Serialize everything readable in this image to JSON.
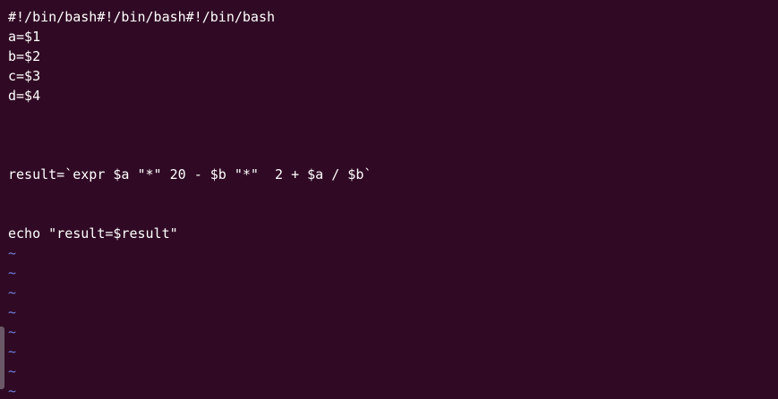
{
  "editor": {
    "lines": [
      "#!/bin/bash#!/bin/bash#!/bin/bash",
      "a=$1",
      "b=$2",
      "c=$3",
      "d=$4",
      "",
      "",
      "",
      "result=`expr $a \"*\" 20 - $b \"*\"  2 + $a / $b`",
      "",
      "",
      "echo \"result=$result\""
    ],
    "empty_marker": "~",
    "empty_marker_count": 8
  },
  "colors": {
    "background": "#300a24",
    "text": "#ffffff",
    "tilde": "#6d7fe0"
  }
}
